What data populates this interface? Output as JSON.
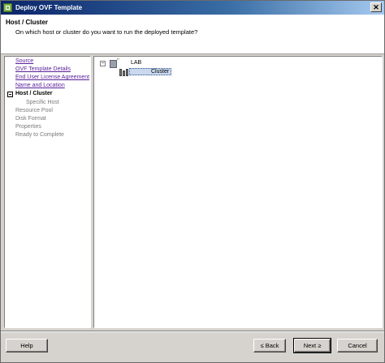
{
  "window": {
    "title": "Deploy OVF Template",
    "close_glyph": "✕"
  },
  "header": {
    "title": "Host / Cluster",
    "description": "On which host or cluster do you want to run the deployed template?"
  },
  "steps": [
    {
      "label": "Source",
      "state": "link"
    },
    {
      "label": "OVF Template Details",
      "state": "link"
    },
    {
      "label": "End User License Agreement",
      "state": "link"
    },
    {
      "label": "Name and Location",
      "state": "link"
    },
    {
      "label": "Host / Cluster",
      "state": "current"
    },
    {
      "label": "Specific Host",
      "state": "disabled-sub"
    },
    {
      "label": "Resource Pool",
      "state": "disabled"
    },
    {
      "label": "Disk Format",
      "state": "disabled"
    },
    {
      "label": "Properties",
      "state": "disabled"
    },
    {
      "label": "Ready to Complete",
      "state": "disabled"
    }
  ],
  "tree": {
    "toggle": "−",
    "datacenter_label": "LAB",
    "datacenter_overlay": "''",
    "cluster_label": "Cluster",
    "icons": {
      "datacenter": "datacenter-icon",
      "cluster": "cluster-icon"
    }
  },
  "buttons": {
    "help": "Help",
    "back": "≤ Back",
    "next": "Next ≥",
    "cancel": "Cancel"
  }
}
